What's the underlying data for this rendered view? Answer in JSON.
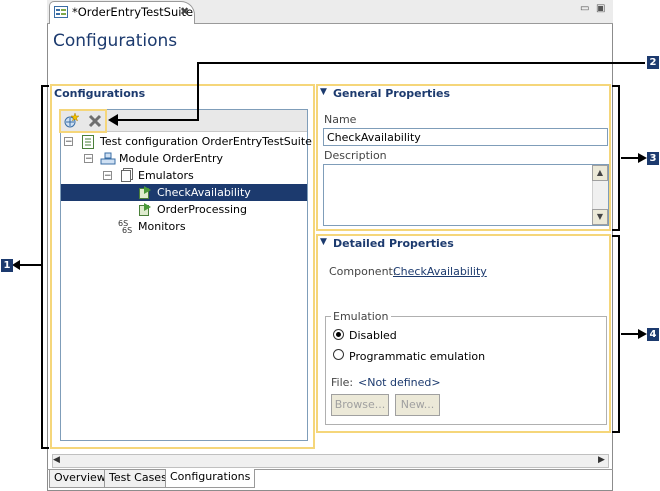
{
  "editor": {
    "tab_title": "*OrderEntryTestSuite",
    "close_glyph": "✖",
    "minimize_glyph": "▭",
    "maximize_glyph": "▣",
    "page_title": "Configurations"
  },
  "configurations_section": {
    "title": "Configurations",
    "toolbar": [
      {
        "icon": "add-emulator-icon",
        "glyph": "✴"
      },
      {
        "icon": "delete-icon",
        "glyph": "✖"
      }
    ],
    "tree": [
      {
        "label": "Test configuration OrderEntryTestSuite",
        "icon": "test-configuration-icon",
        "expander": "−"
      },
      {
        "label": "Module OrderEntry",
        "icon": "module-icon",
        "expander": "−"
      },
      {
        "label": "Emulators",
        "icon": "emulators-folder-icon",
        "expander": "−"
      },
      {
        "label": "CheckAvailability",
        "icon": "emulator-icon",
        "selected": true
      },
      {
        "label": "OrderProcessing",
        "icon": "emulator-icon"
      },
      {
        "label": "Monitors",
        "icon": "monitors-icon"
      }
    ]
  },
  "general_properties": {
    "title": "General Properties",
    "collapse_glyph": "▼",
    "name_label": "Name",
    "name_value": "CheckAvailability",
    "description_label": "Description",
    "description_value": "",
    "scroll_up": "▲",
    "scroll_down": "▼"
  },
  "detailed_properties": {
    "title": "Detailed Properties",
    "collapse_glyph": "▼",
    "component_label": "Component:",
    "component_value": "CheckAvailability",
    "emulation_group_label": "Emulation",
    "radio_disabled": "Disabled",
    "radio_programmatic": "Programmatic emulation",
    "selected_radio": "Disabled",
    "file_label": "File:",
    "file_value": "<Not defined>",
    "browse_button": "Browse...",
    "new_button": "New..."
  },
  "scrollbar": {
    "left": "◀",
    "right": "▶"
  },
  "bottom_tabs": [
    "Overview",
    "Test Cases",
    "Configurations"
  ],
  "active_bottom_tab": "Configurations",
  "callouts": [
    "1",
    "2",
    "3",
    "4"
  ],
  "colors": {
    "title_blue": "#1c3a6e",
    "highlight_yellow": "#f5d67a",
    "selection": "#1c3a6e"
  }
}
